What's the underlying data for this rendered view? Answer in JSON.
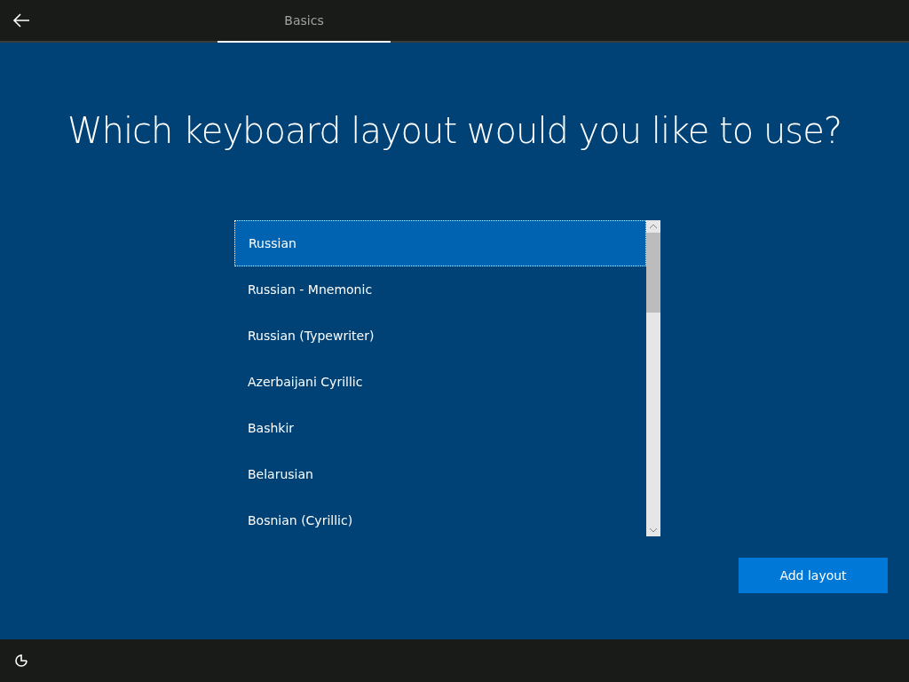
{
  "tabs": [
    {
      "label": "Basics",
      "selected": true
    }
  ],
  "heading": "Which keyboard layout would you like to use?",
  "layouts": [
    {
      "label": "Russian",
      "selected": true
    },
    {
      "label": "Russian - Mnemonic",
      "selected": false
    },
    {
      "label": "Russian (Typewriter)",
      "selected": false
    },
    {
      "label": "Azerbaijani Cyrillic",
      "selected": false
    },
    {
      "label": "Bashkir",
      "selected": false
    },
    {
      "label": "Belarusian",
      "selected": false
    },
    {
      "label": "Bosnian (Cyrillic)",
      "selected": false
    }
  ],
  "button": "Add layout"
}
